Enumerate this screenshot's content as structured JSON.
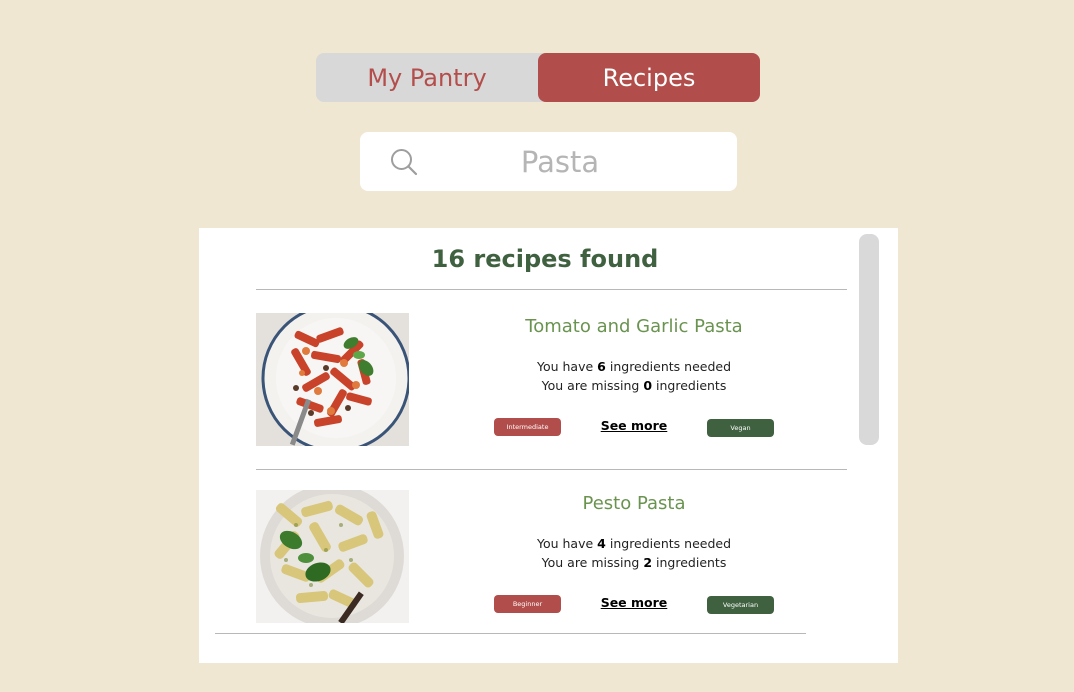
{
  "tabs": [
    {
      "label": "My Pantry",
      "active": false
    },
    {
      "label": "Recipes",
      "active": true
    }
  ],
  "search": {
    "value": "Pasta",
    "icon": "search-icon"
  },
  "results": {
    "title": "16 recipes found"
  },
  "recipes": [
    {
      "title": "Tomato and Garlic Pasta",
      "have_prefix": "You have",
      "have_count": "6",
      "have_suffix": "ingredients needed",
      "missing_prefix": "You are missing",
      "missing_count": "0",
      "missing_suffix": "ingredients",
      "level": "Intermediate",
      "see_more": "See more",
      "diet": "Vegan"
    },
    {
      "title": "Pesto Pasta",
      "have_prefix": "You have",
      "have_count": "4",
      "have_suffix": "ingredients needed",
      "missing_prefix": "You are missing",
      "missing_count": "2",
      "missing_suffix": "ingredients",
      "level": "Beginner",
      "see_more": "See more",
      "diet": "Vegetarian"
    }
  ],
  "colors": {
    "background": "#f0e7d3",
    "accent_red": "#b14d4b",
    "accent_green": "#3f6140",
    "title_green": "#6a9350"
  }
}
